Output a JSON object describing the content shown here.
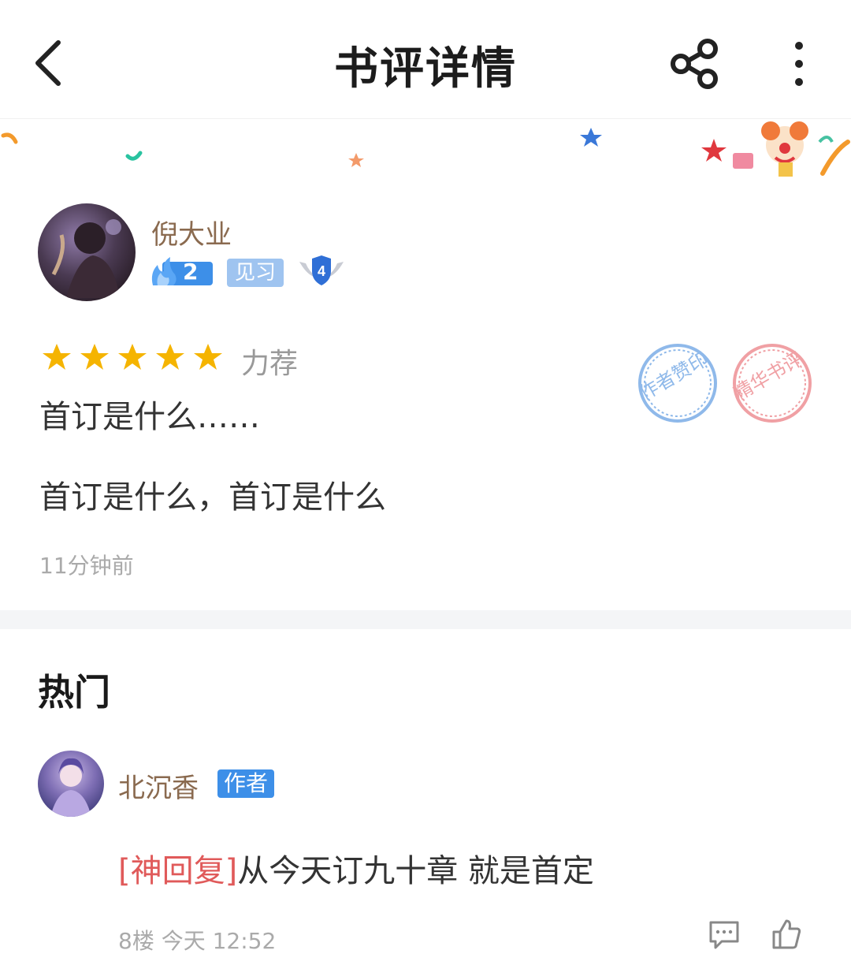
{
  "header": {
    "title": "书评详情"
  },
  "review": {
    "username": "倪大业",
    "level": "2",
    "rank_title": "见习",
    "badge_level": "4",
    "rating_stars": 5,
    "rating_label": "力荐",
    "title": "首订是什么……",
    "body": "首订是什么，首订是什么",
    "time": "11分钟前",
    "seals": [
      "作者赞印",
      "精华书评"
    ]
  },
  "hot": {
    "section_title": "热门",
    "comment": {
      "username": "北沉香",
      "author_tag": "作者",
      "tag": "[神回复]",
      "text": "从今天订九十章 就是首定",
      "meta": "8楼 今天 12:52"
    }
  },
  "colors": {
    "star": "#f5b400",
    "username": "#8a6a4f",
    "author_tag_bg": "#3d8fe8",
    "rank_badge_bg": "#9fc4f0",
    "god_reply": "#e05a5a"
  }
}
